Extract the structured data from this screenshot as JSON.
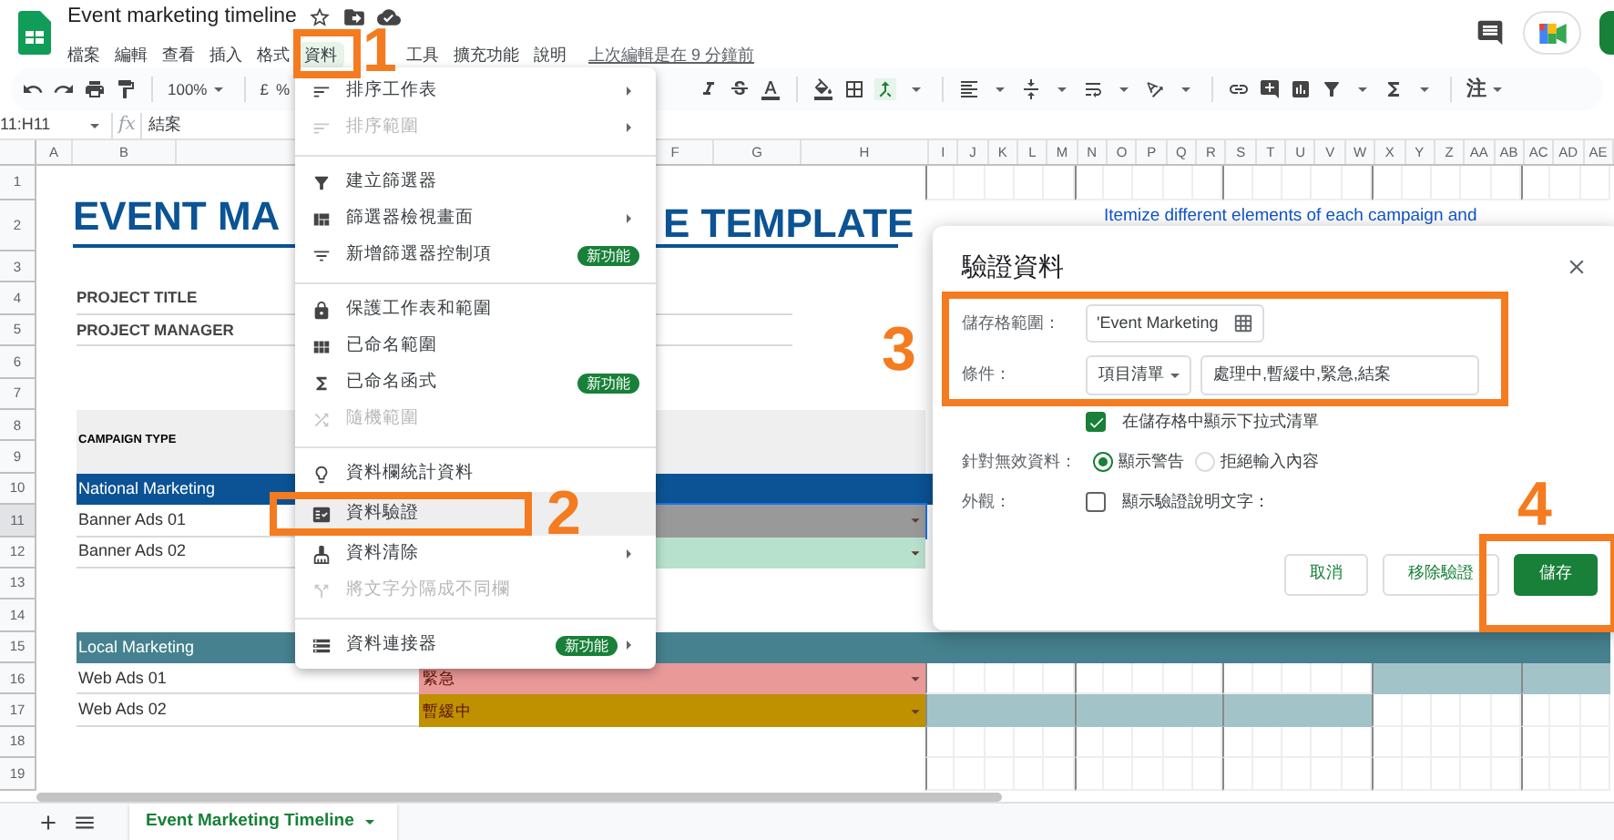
{
  "app": {
    "title": "Event marketing timeline",
    "menus": [
      {
        "label": "檔案",
        "selected": false
      },
      {
        "label": "編輯",
        "selected": false
      },
      {
        "label": "查看",
        "selected": false
      },
      {
        "label": "插入",
        "selected": false
      },
      {
        "label": "格式",
        "selected": false
      },
      {
        "label": "資料",
        "selected": true
      },
      {
        "label": "工具",
        "selected": false
      },
      {
        "label": "擴充功能",
        "selected": false
      },
      {
        "label": "說明",
        "selected": false
      }
    ],
    "last_edit": "上次編輯是在 9 分鐘前"
  },
  "toolbar": {
    "zoom": "100%",
    "currency": "£",
    "percent": "%",
    "note": "注"
  },
  "formula_bar": {
    "cell_ref": "11:H11",
    "fx": "fx",
    "value": "結案"
  },
  "sheet": {
    "column_headers": [
      "A",
      "B",
      "F",
      "G",
      "H",
      "I",
      "J",
      "K",
      "L",
      "M",
      "N",
      "O",
      "P",
      "Q",
      "R",
      "S",
      "T",
      "U",
      "V",
      "W",
      "X",
      "Y",
      "Z",
      "AA",
      "AB",
      "AC",
      "AD",
      "AE"
    ],
    "rows": [
      {
        "num": "1",
        "selected": false,
        "kind": "blank"
      },
      {
        "num": "2",
        "selected": false,
        "kind": "title",
        "title_parts": [
          "EVENT MA",
          "E TEMPLATE"
        ],
        "note": "Itemize different elements of each campaign and"
      },
      {
        "num": "3",
        "selected": false,
        "kind": "blank"
      },
      {
        "num": "4",
        "selected": false,
        "kind": "field",
        "label": "PROJECT TITLE"
      },
      {
        "num": "5",
        "selected": false,
        "kind": "field",
        "label": "PROJECT MANAGER"
      },
      {
        "num": "6",
        "selected": false,
        "kind": "blank"
      },
      {
        "num": "7",
        "selected": false,
        "kind": "blank"
      },
      {
        "num": "8",
        "selected": false,
        "kind": "header",
        "label": "CAMPAIGN TYPE"
      },
      {
        "num": "9",
        "selected": false,
        "kind": "merged"
      },
      {
        "num": "10",
        "selected": false,
        "kind": "section",
        "label": "National Marketing",
        "color": "#0b5394"
      },
      {
        "num": "11",
        "selected": true,
        "kind": "task",
        "label": "Banner Ads 01",
        "status": {
          "color": "#999999"
        }
      },
      {
        "num": "12",
        "selected": false,
        "kind": "task",
        "label": "Banner Ads 02",
        "status": {
          "color": "#b7e1cd"
        }
      },
      {
        "num": "13",
        "selected": false,
        "kind": "blank"
      },
      {
        "num": "14",
        "selected": false,
        "kind": "blank"
      },
      {
        "num": "15",
        "selected": false,
        "kind": "section",
        "label": "Local Marketing",
        "color": "#45818e"
      },
      {
        "num": "16",
        "selected": false,
        "kind": "task",
        "label": "Web Ads 01",
        "status": {
          "color": "#ea9999",
          "text": "緊急"
        },
        "timeline": [
          false,
          false,
          false,
          false,
          false,
          false,
          false,
          false,
          false,
          false,
          false,
          false,
          false,
          false,
          false,
          true,
          true,
          true,
          true,
          true,
          true,
          true,
          true
        ]
      },
      {
        "num": "17",
        "selected": false,
        "kind": "task",
        "label": "Web Ads 02",
        "status": {
          "color": "#bf9000",
          "text": "暫緩中"
        },
        "timeline": [
          true,
          true,
          true,
          true,
          true,
          true,
          true,
          true,
          true,
          true,
          true,
          true,
          true,
          true,
          true,
          false,
          false,
          false,
          false,
          false,
          false,
          false,
          false
        ]
      },
      {
        "num": "18",
        "selected": false,
        "kind": "blank"
      },
      {
        "num": "19",
        "selected": false,
        "kind": "blank"
      }
    ]
  },
  "menu": {
    "items": [
      {
        "kind": "item",
        "label": "排序工作表",
        "disabled": false,
        "submenu": true,
        "selected": false
      },
      {
        "kind": "item",
        "label": "排序範圍",
        "disabled": true,
        "submenu": true,
        "selected": false
      },
      {
        "kind": "divider"
      },
      {
        "kind": "item",
        "label": "建立篩選器",
        "disabled": false,
        "submenu": false,
        "selected": false
      },
      {
        "kind": "item",
        "label": "篩選器檢視畫面",
        "disabled": false,
        "submenu": true,
        "selected": false
      },
      {
        "kind": "item",
        "label": "新增篩選器控制項",
        "disabled": false,
        "submenu": false,
        "selected": false,
        "badge": "新功能"
      },
      {
        "kind": "divider"
      },
      {
        "kind": "item",
        "label": "保護工作表和範圍",
        "disabled": false,
        "submenu": false,
        "selected": false
      },
      {
        "kind": "item",
        "label": "已命名範圍",
        "disabled": false,
        "submenu": false,
        "selected": false
      },
      {
        "kind": "item",
        "label": "已命名函式",
        "disabled": false,
        "submenu": false,
        "selected": false,
        "badge": "新功能"
      },
      {
        "kind": "item",
        "label": "隨機範圍",
        "disabled": true,
        "submenu": false,
        "selected": false
      },
      {
        "kind": "divider"
      },
      {
        "kind": "item",
        "label": "資料欄統計資料",
        "disabled": false,
        "submenu": false,
        "selected": false
      },
      {
        "kind": "item",
        "label": "資料驗證",
        "disabled": false,
        "submenu": false,
        "selected": true
      },
      {
        "kind": "item",
        "label": "資料清除",
        "disabled": false,
        "submenu": true,
        "selected": false
      },
      {
        "kind": "item",
        "label": "將文字分隔成不同欄",
        "disabled": true,
        "submenu": false,
        "selected": false
      },
      {
        "kind": "divider"
      },
      {
        "kind": "item",
        "label": "資料連接器",
        "disabled": false,
        "submenu": true,
        "selected": false,
        "badge": "新功能"
      }
    ]
  },
  "dialog": {
    "title": "驗證資料",
    "range_label": "儲存格範圍：",
    "range_value": "'Event Marketing",
    "criteria_label": "條件：",
    "criteria_type": "項目清單",
    "criteria_value": "處理中,暫緩中,緊急,結案",
    "show_dropdown": {
      "label": "在儲存格中顯示下拉式清單",
      "checked": true
    },
    "invalid_label": "針對無效資料：",
    "invalid_options": [
      {
        "label": "顯示警告",
        "selected": true
      },
      {
        "label": "拒絕輸入內容",
        "selected": false
      }
    ],
    "appearance_label": "外觀：",
    "help_text": {
      "label": "顯示驗證說明文字：",
      "checked": false
    },
    "buttons": [
      {
        "label": "取消",
        "kind": "secondary"
      },
      {
        "label": "移除驗證",
        "kind": "secondary"
      },
      {
        "label": "儲存",
        "kind": "primary"
      }
    ]
  },
  "annotations": [
    {
      "label": "1"
    },
    {
      "label": "2"
    },
    {
      "label": "3"
    },
    {
      "label": "4"
    }
  ],
  "sheet_tabs": [
    {
      "label": "Event Marketing Timeline",
      "selected": true
    }
  ]
}
